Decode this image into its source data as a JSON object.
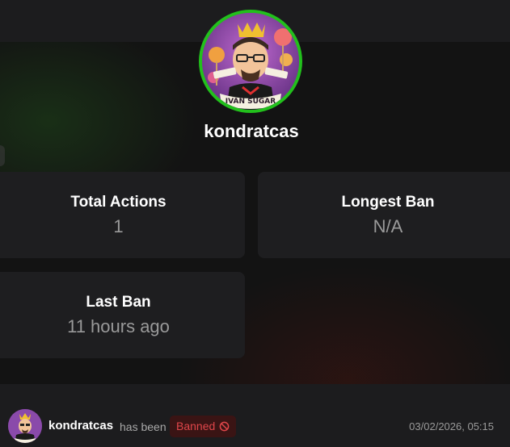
{
  "profile": {
    "username": "kondratcas",
    "avatar_text": "IVAN SUGAR",
    "avatar_border_color": "#22c01c"
  },
  "stats": {
    "total_actions": {
      "label": "Total Actions",
      "value": "1"
    },
    "longest_ban": {
      "label": "Longest Ban",
      "value": "N/A"
    },
    "last_ban": {
      "label": "Last Ban",
      "value": "11 hours ago"
    }
  },
  "activity": {
    "user": "kondratcas",
    "text": "has been",
    "badge": "Banned",
    "badge_icon": "ban-icon",
    "badge_color": "#e0464a",
    "timestamp": "03/02/2026, 05:15"
  }
}
